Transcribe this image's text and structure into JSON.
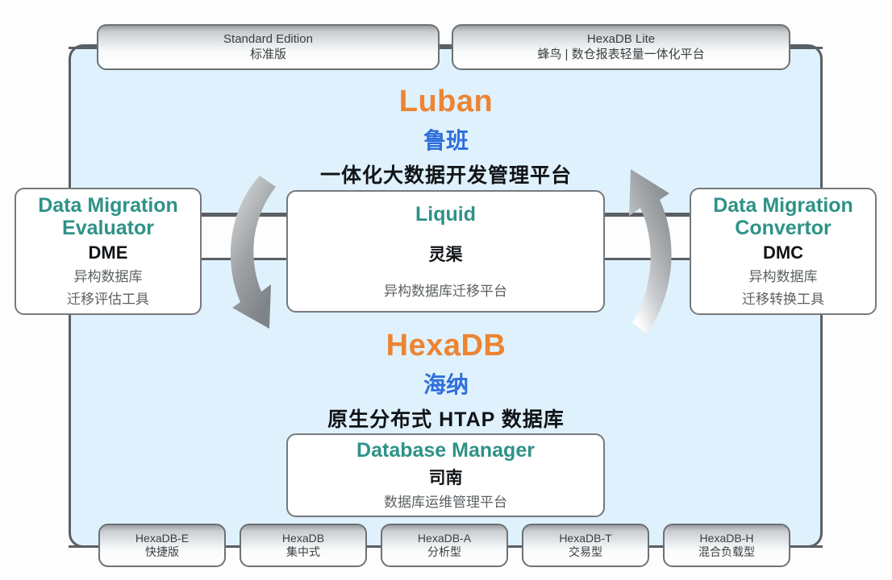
{
  "diagram": {
    "title": "Luban / HexaDB product architecture diagram",
    "colors": {
      "frame_fill": "#dff1fc",
      "frame_border": "#5a5f63",
      "brand_orange": "#ed8432",
      "brand_blue": "#2f6fdb",
      "product_teal": "#2e9287",
      "text_dark": "#111417",
      "text_grey": "#5c6063"
    }
  },
  "top_pills": [
    {
      "en": "Standard Edition",
      "cn": "标准版"
    },
    {
      "en": "HexaDB Lite",
      "cn": "蜂鸟 | 数仓报表轻量一体化平台"
    }
  ],
  "luban": {
    "brand": "Luban",
    "brand_cn": "鲁班",
    "tagline": "一体化大数据开发管理平台"
  },
  "hexadb": {
    "brand": "HexaDB",
    "brand_cn": "海纳",
    "tagline": "原生分布式 HTAP 数据库"
  },
  "left_card": {
    "en_line1": "Data Migration",
    "en_line2": "Evaluator",
    "abbr": "DME",
    "cn_line1": "异构数据库",
    "cn_line2": "迁移评估工具"
  },
  "right_card": {
    "en_line1": "Data Migration",
    "en_line2": "Convertor",
    "abbr": "DMC",
    "cn_line1": "异构数据库",
    "cn_line2": "迁移转换工具"
  },
  "center_card": {
    "en": "Liquid",
    "cn_name": "灵渠",
    "cn_desc": "异构数据库迁移平台"
  },
  "dbm_card": {
    "en": "Database Manager",
    "cn_name": "司南",
    "cn_desc": "数据库运维管理平台"
  },
  "bottom_pills": [
    {
      "en": "HexaDB-E",
      "cn": "快捷版"
    },
    {
      "en": "HexaDB",
      "cn": "集中式"
    },
    {
      "en": "HexaDB-A",
      "cn": "分析型"
    },
    {
      "en": "HexaDB-T",
      "cn": "交易型"
    },
    {
      "en": "HexaDB-H",
      "cn": "混合负载型"
    }
  ],
  "arrows": [
    {
      "name": "left-curved-arrow-down",
      "direction": "clockwise-down"
    },
    {
      "name": "right-curved-arrow-up",
      "direction": "counterclockwise-up"
    }
  ]
}
